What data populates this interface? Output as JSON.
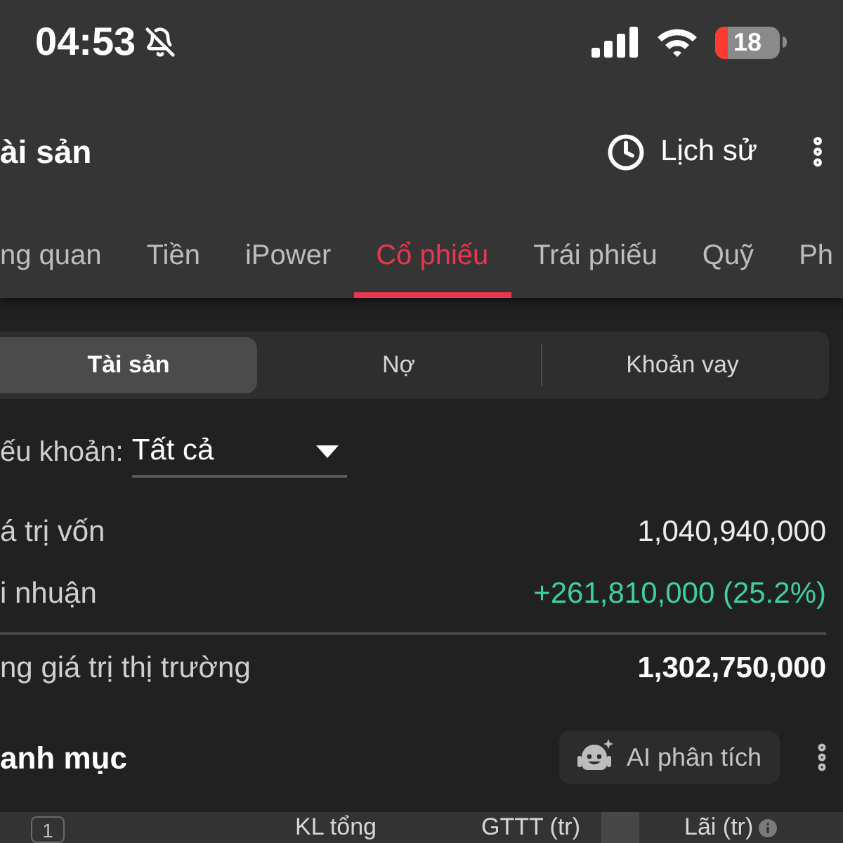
{
  "status_bar": {
    "time": "04:53",
    "battery": "18"
  },
  "header": {
    "title": "ài sản",
    "history_button": "Lịch sử"
  },
  "tabs": [
    {
      "label": "ng quan",
      "selected": false
    },
    {
      "label": "Tiền",
      "selected": false
    },
    {
      "label": "iPower",
      "selected": false
    },
    {
      "label": "Cổ phiếu",
      "selected": true
    },
    {
      "label": "Trái phiếu",
      "selected": false
    },
    {
      "label": "Quỹ",
      "selected": false
    },
    {
      "label": "Ph",
      "selected": false
    }
  ],
  "segments": [
    {
      "label": "Tài sản",
      "selected": true
    },
    {
      "label": "Nợ",
      "selected": false
    },
    {
      "label": "Khoản vay",
      "selected": false
    }
  ],
  "filter": {
    "label": "ếu khoản:",
    "value": "Tất cả"
  },
  "summary": [
    {
      "label": "á trị vốn",
      "value": "1,040,940,000",
      "kind": "plain"
    },
    {
      "label": "i nhuận",
      "value": "+261,810,000 (25.2%)",
      "kind": "gain"
    },
    {
      "label": "ng giá trị thị trường",
      "value": "1,302,750,000",
      "kind": "total"
    }
  ],
  "portfolio": {
    "title": "anh mục",
    "ai_button": "AI phân tích"
  },
  "table": {
    "count": "1",
    "columns": [
      {
        "kind": "text",
        "label": "KL tổng",
        "info": false
      },
      {
        "kind": "text",
        "label": "GTTT (tr)",
        "info": false
      },
      {
        "kind": "shaded"
      },
      {
        "kind": "text",
        "label": "Lãi (tr)",
        "info": true
      }
    ]
  }
}
